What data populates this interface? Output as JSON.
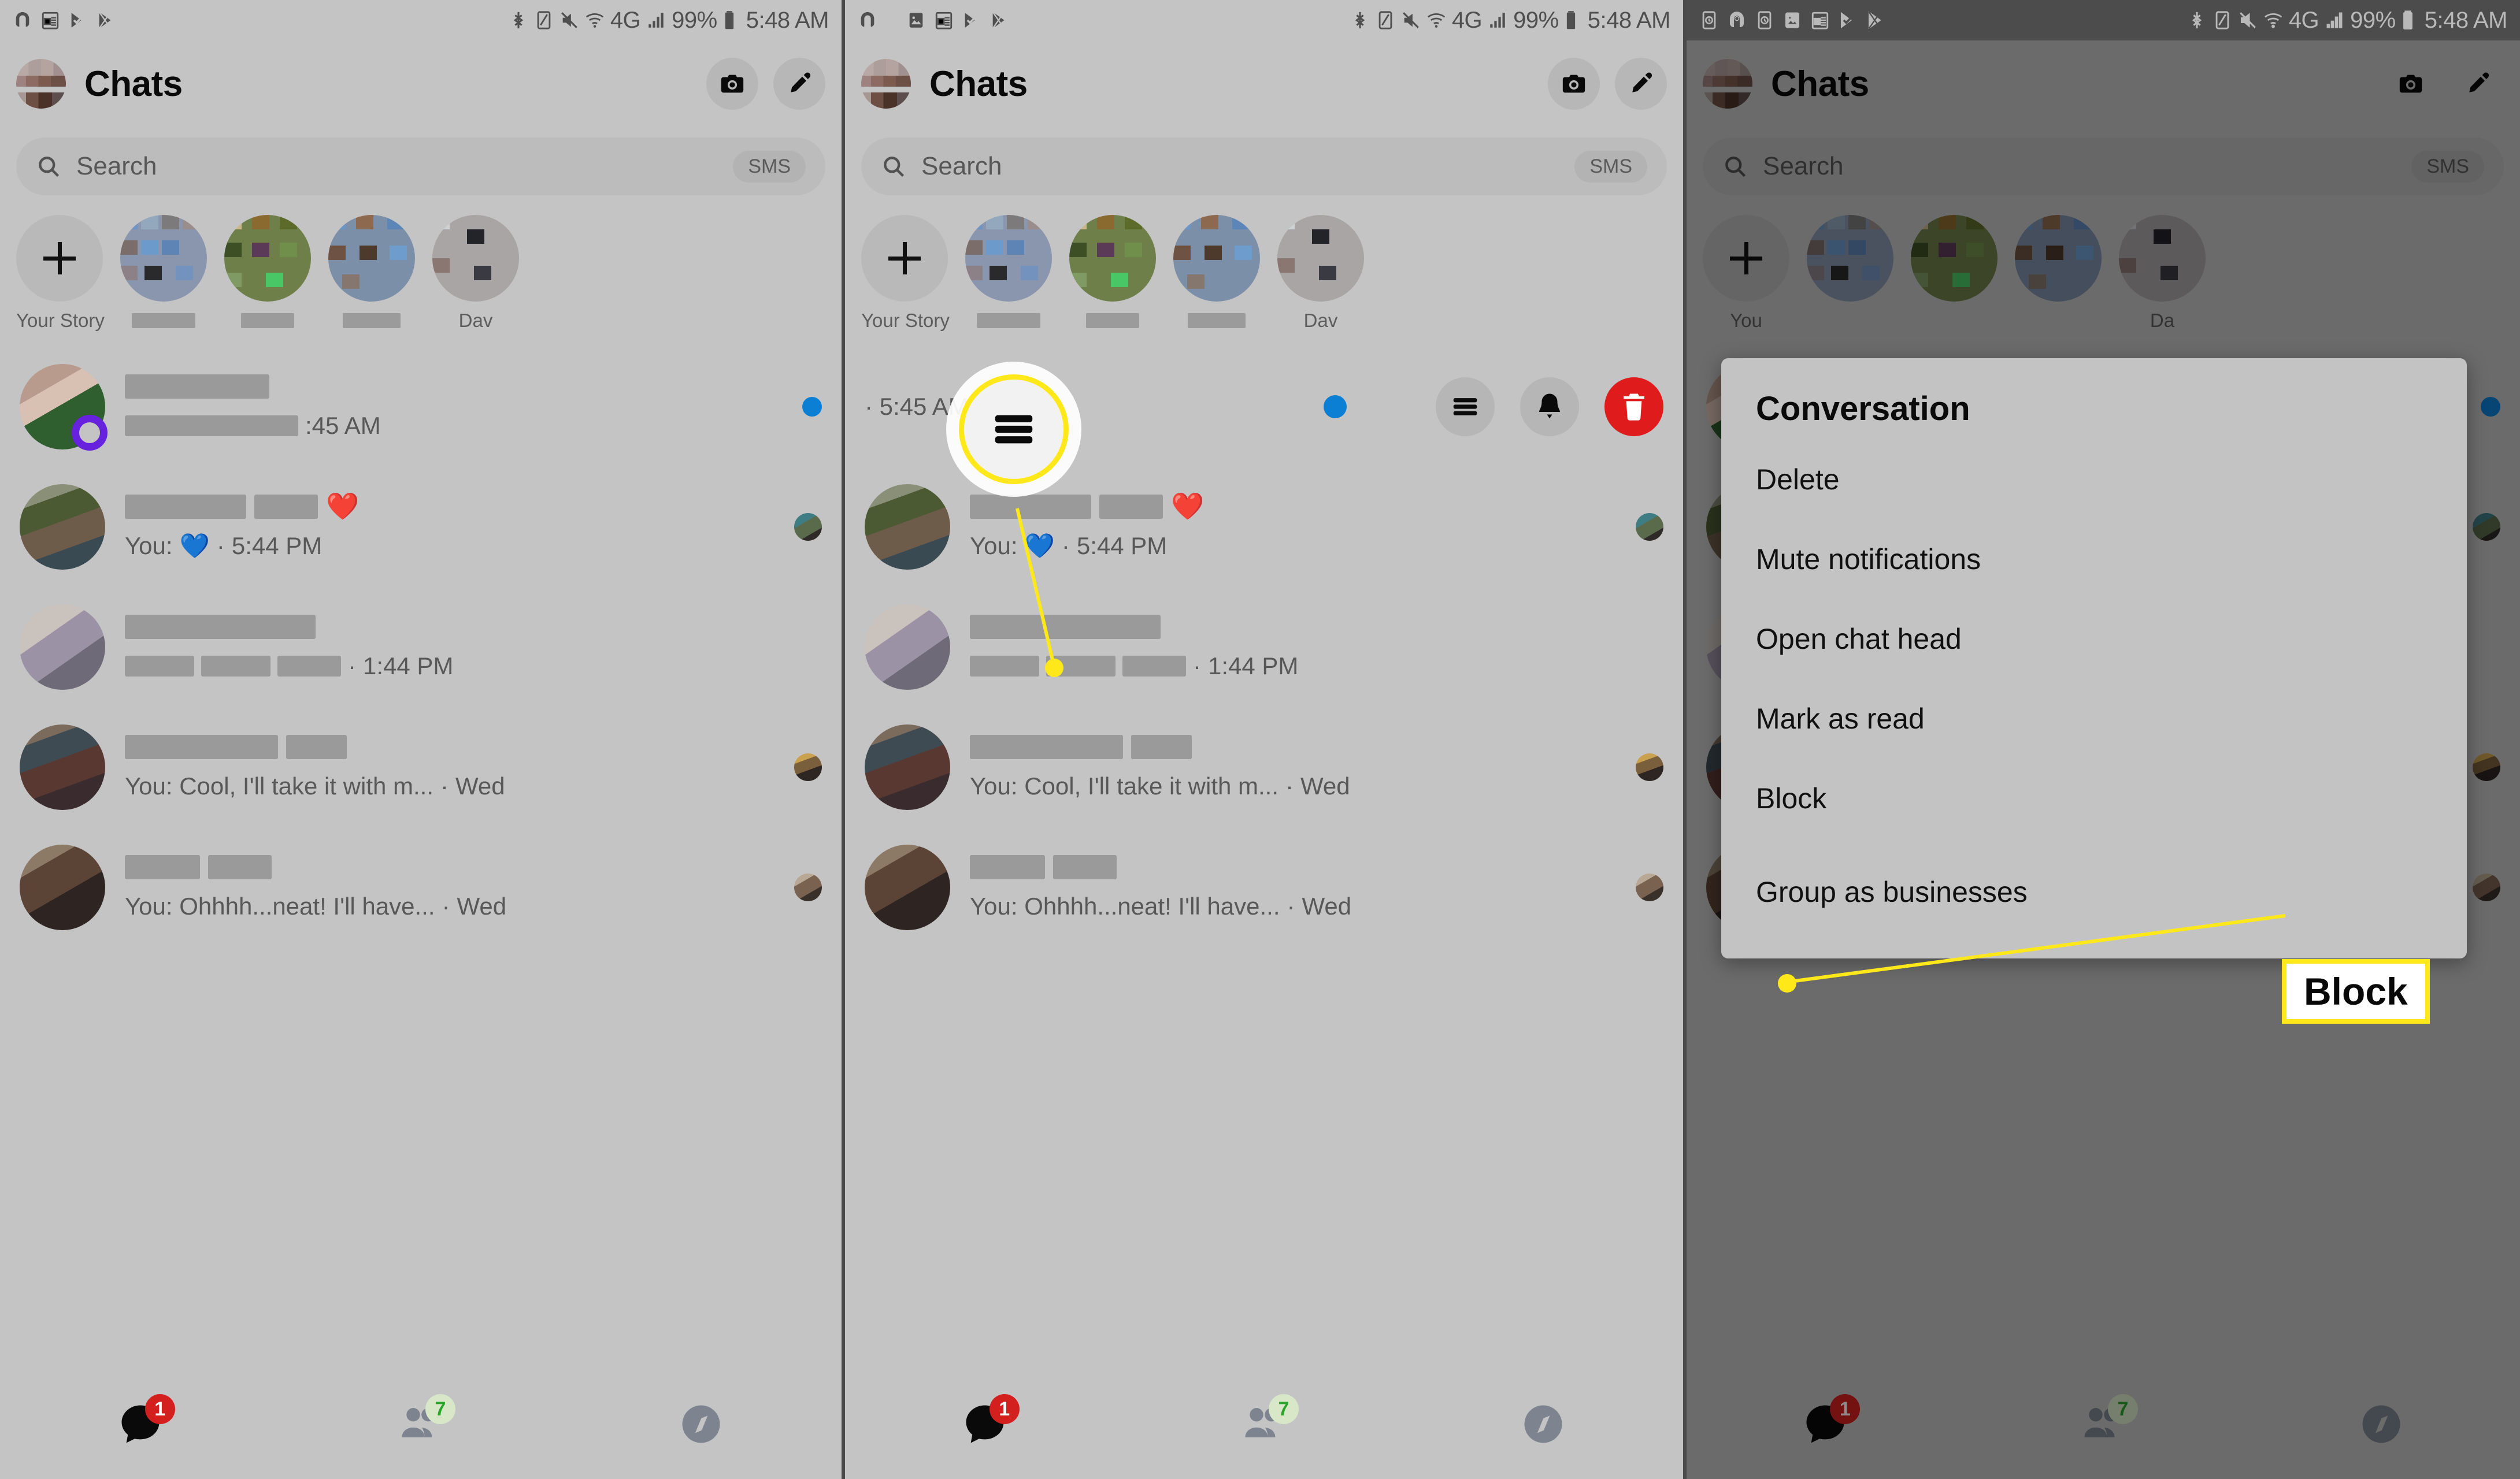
{
  "statusbar": {
    "battery_percent": "99%",
    "time": "5:48 AM",
    "network": "4G",
    "icons_left": [
      "headphones-icon",
      "notepad-icon",
      "play-check-icon",
      "play-store-icon"
    ],
    "icons_left_p2": [
      "headphones-icon",
      "image-icon",
      "notepad-icon",
      "play-check-icon",
      "play-store-icon"
    ],
    "icons_left_p3": [
      "alarm-icon",
      "headphones-icon",
      "alarm2-icon",
      "image-icon",
      "notepad-icon",
      "play-check-icon",
      "play-store-icon"
    ],
    "icons_right": [
      "bluetooth-icon",
      "nfc-icon",
      "mute-icon",
      "wifi-icon",
      "4g-icon",
      "signal-icon",
      "battery-icon"
    ]
  },
  "header": {
    "title": "Chats",
    "avatar": "profile-avatar",
    "camera_label": "camera-icon",
    "compose_label": "compose-icon"
  },
  "search": {
    "placeholder": "Search",
    "sms_chip": "SMS",
    "icon": "search-icon"
  },
  "stories": {
    "add_label": "Your Story",
    "add_icon": "plus-icon",
    "items": [
      {
        "label": "",
        "redacted": true
      },
      {
        "label": "",
        "redacted": true
      },
      {
        "label": "",
        "redacted": true
      },
      {
        "label": "Dav",
        "redacted": false
      }
    ]
  },
  "chats": [
    {
      "name_redacted": true,
      "preview_redacted": true,
      "timestamp": ":45 AM",
      "unread": true,
      "unread_dot_color": "#0b7fd4",
      "story_ring": true,
      "avatar": "chat-avatar-1"
    },
    {
      "name_redacted": true,
      "preview_prefix": "You:",
      "preview_emoji": "💙",
      "name_emoji": "❤️",
      "timestamp": "5:44 PM",
      "unread": false,
      "avatar": "chat-avatar-2",
      "mini_avatar": "mini-avatar-a"
    },
    {
      "name_redacted": true,
      "preview_redacted": true,
      "timestamp": "1:44 PM",
      "unread": false,
      "avatar": "chat-avatar-3"
    },
    {
      "name_redacted": true,
      "preview_text": "You: Cool, I'll take it with m...",
      "timestamp": "Wed",
      "unread": false,
      "avatar": "chat-avatar-4",
      "mini_avatar": "mini-avatar-b"
    },
    {
      "name_redacted": true,
      "preview_text": "You: Ohhhh...neat! I'll have...",
      "timestamp": "Wed",
      "unread": false,
      "avatar": "chat-avatar-5",
      "mini_avatar": "mini-avatar-c"
    }
  ],
  "panel2": {
    "row_timestamp": "· 5:45 AM",
    "actions": [
      {
        "name": "unread-dot",
        "icon": "blue-dot"
      },
      {
        "name": "more-options-button",
        "icon": "hamburger-icon"
      },
      {
        "name": "mute-button",
        "icon": "bell-icon"
      },
      {
        "name": "delete-button",
        "icon": "trash-icon"
      }
    ],
    "callout": {
      "icon": "hamburger-icon",
      "color": "#ffe81a"
    }
  },
  "panel3": {
    "menu": {
      "title": "Conversation",
      "items": [
        "Delete",
        "Mute notifications",
        "Open chat head",
        "Mark as read",
        "Block",
        "Group as businesses"
      ]
    },
    "callout_label": "Block",
    "callout_color": "#ffe81a",
    "partial_story_label": "You",
    "partial_story_label_right": "Da"
  },
  "bottomnav": {
    "items": [
      {
        "name": "chats-tab",
        "icon": "chat-bubble-icon",
        "badge": "1",
        "badge_color": "#d41f1f",
        "active": true
      },
      {
        "name": "people-tab",
        "icon": "people-icon",
        "badge": "7",
        "badge_color": "#2aa52a",
        "active": false
      },
      {
        "name": "discover-tab",
        "icon": "compass-icon",
        "badge": "",
        "active": false
      }
    ]
  },
  "colors": {
    "accent_blue": "#0b7fd4",
    "highlight_yellow": "#ffe81a",
    "delete_red": "#e01b1b",
    "story_ring_purple": "#6622dd",
    "background": "#c4c4c4"
  }
}
